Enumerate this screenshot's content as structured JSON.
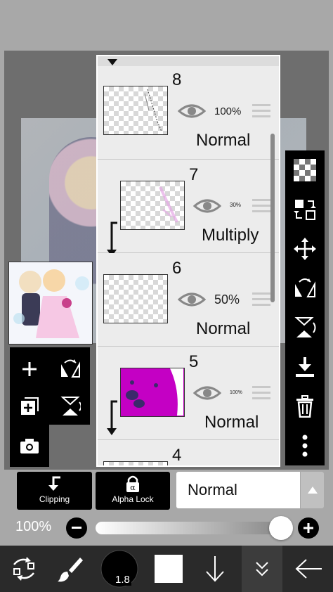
{
  "layers": [
    {
      "number": "8",
      "opacity": "100%",
      "blend": "Normal",
      "clipped": false
    },
    {
      "number": "7",
      "opacity": "30%",
      "blend": "Multiply",
      "clipped": true
    },
    {
      "number": "6",
      "opacity": "50%",
      "blend": "Normal",
      "clipped": false
    },
    {
      "number": "5",
      "opacity": "100%",
      "blend": "Normal",
      "clipped": true
    },
    {
      "number": "4"
    }
  ],
  "layer_buttons": {
    "clipping": "Clipping",
    "alpha_lock": "Alpha Lock"
  },
  "blend_mode": {
    "selected": "Normal"
  },
  "opacity": {
    "label": "100%",
    "value": 1.0
  },
  "brush": {
    "size": "1.8"
  },
  "icons": {
    "left_tools": [
      "plus-icon",
      "flip-layer-icon",
      "add-layer-icon",
      "flip-vertical-icon",
      "camera-icon"
    ],
    "right_tools": [
      "checker-icon",
      "swap-icon",
      "move-icon",
      "flip-horizontal-icon",
      "flip-vertical-icon",
      "download-icon",
      "trash-icon",
      "more-icon"
    ],
    "bottom": [
      "transform-icon",
      "brush-icon",
      "color-swatch",
      "arrow-down-icon",
      "chevron-down-icon",
      "arrow-left-icon"
    ]
  },
  "colors": {
    "accent_layer5": "#c400c4",
    "panel_bg": "#ececec",
    "toolbar_bg": "#000000"
  }
}
